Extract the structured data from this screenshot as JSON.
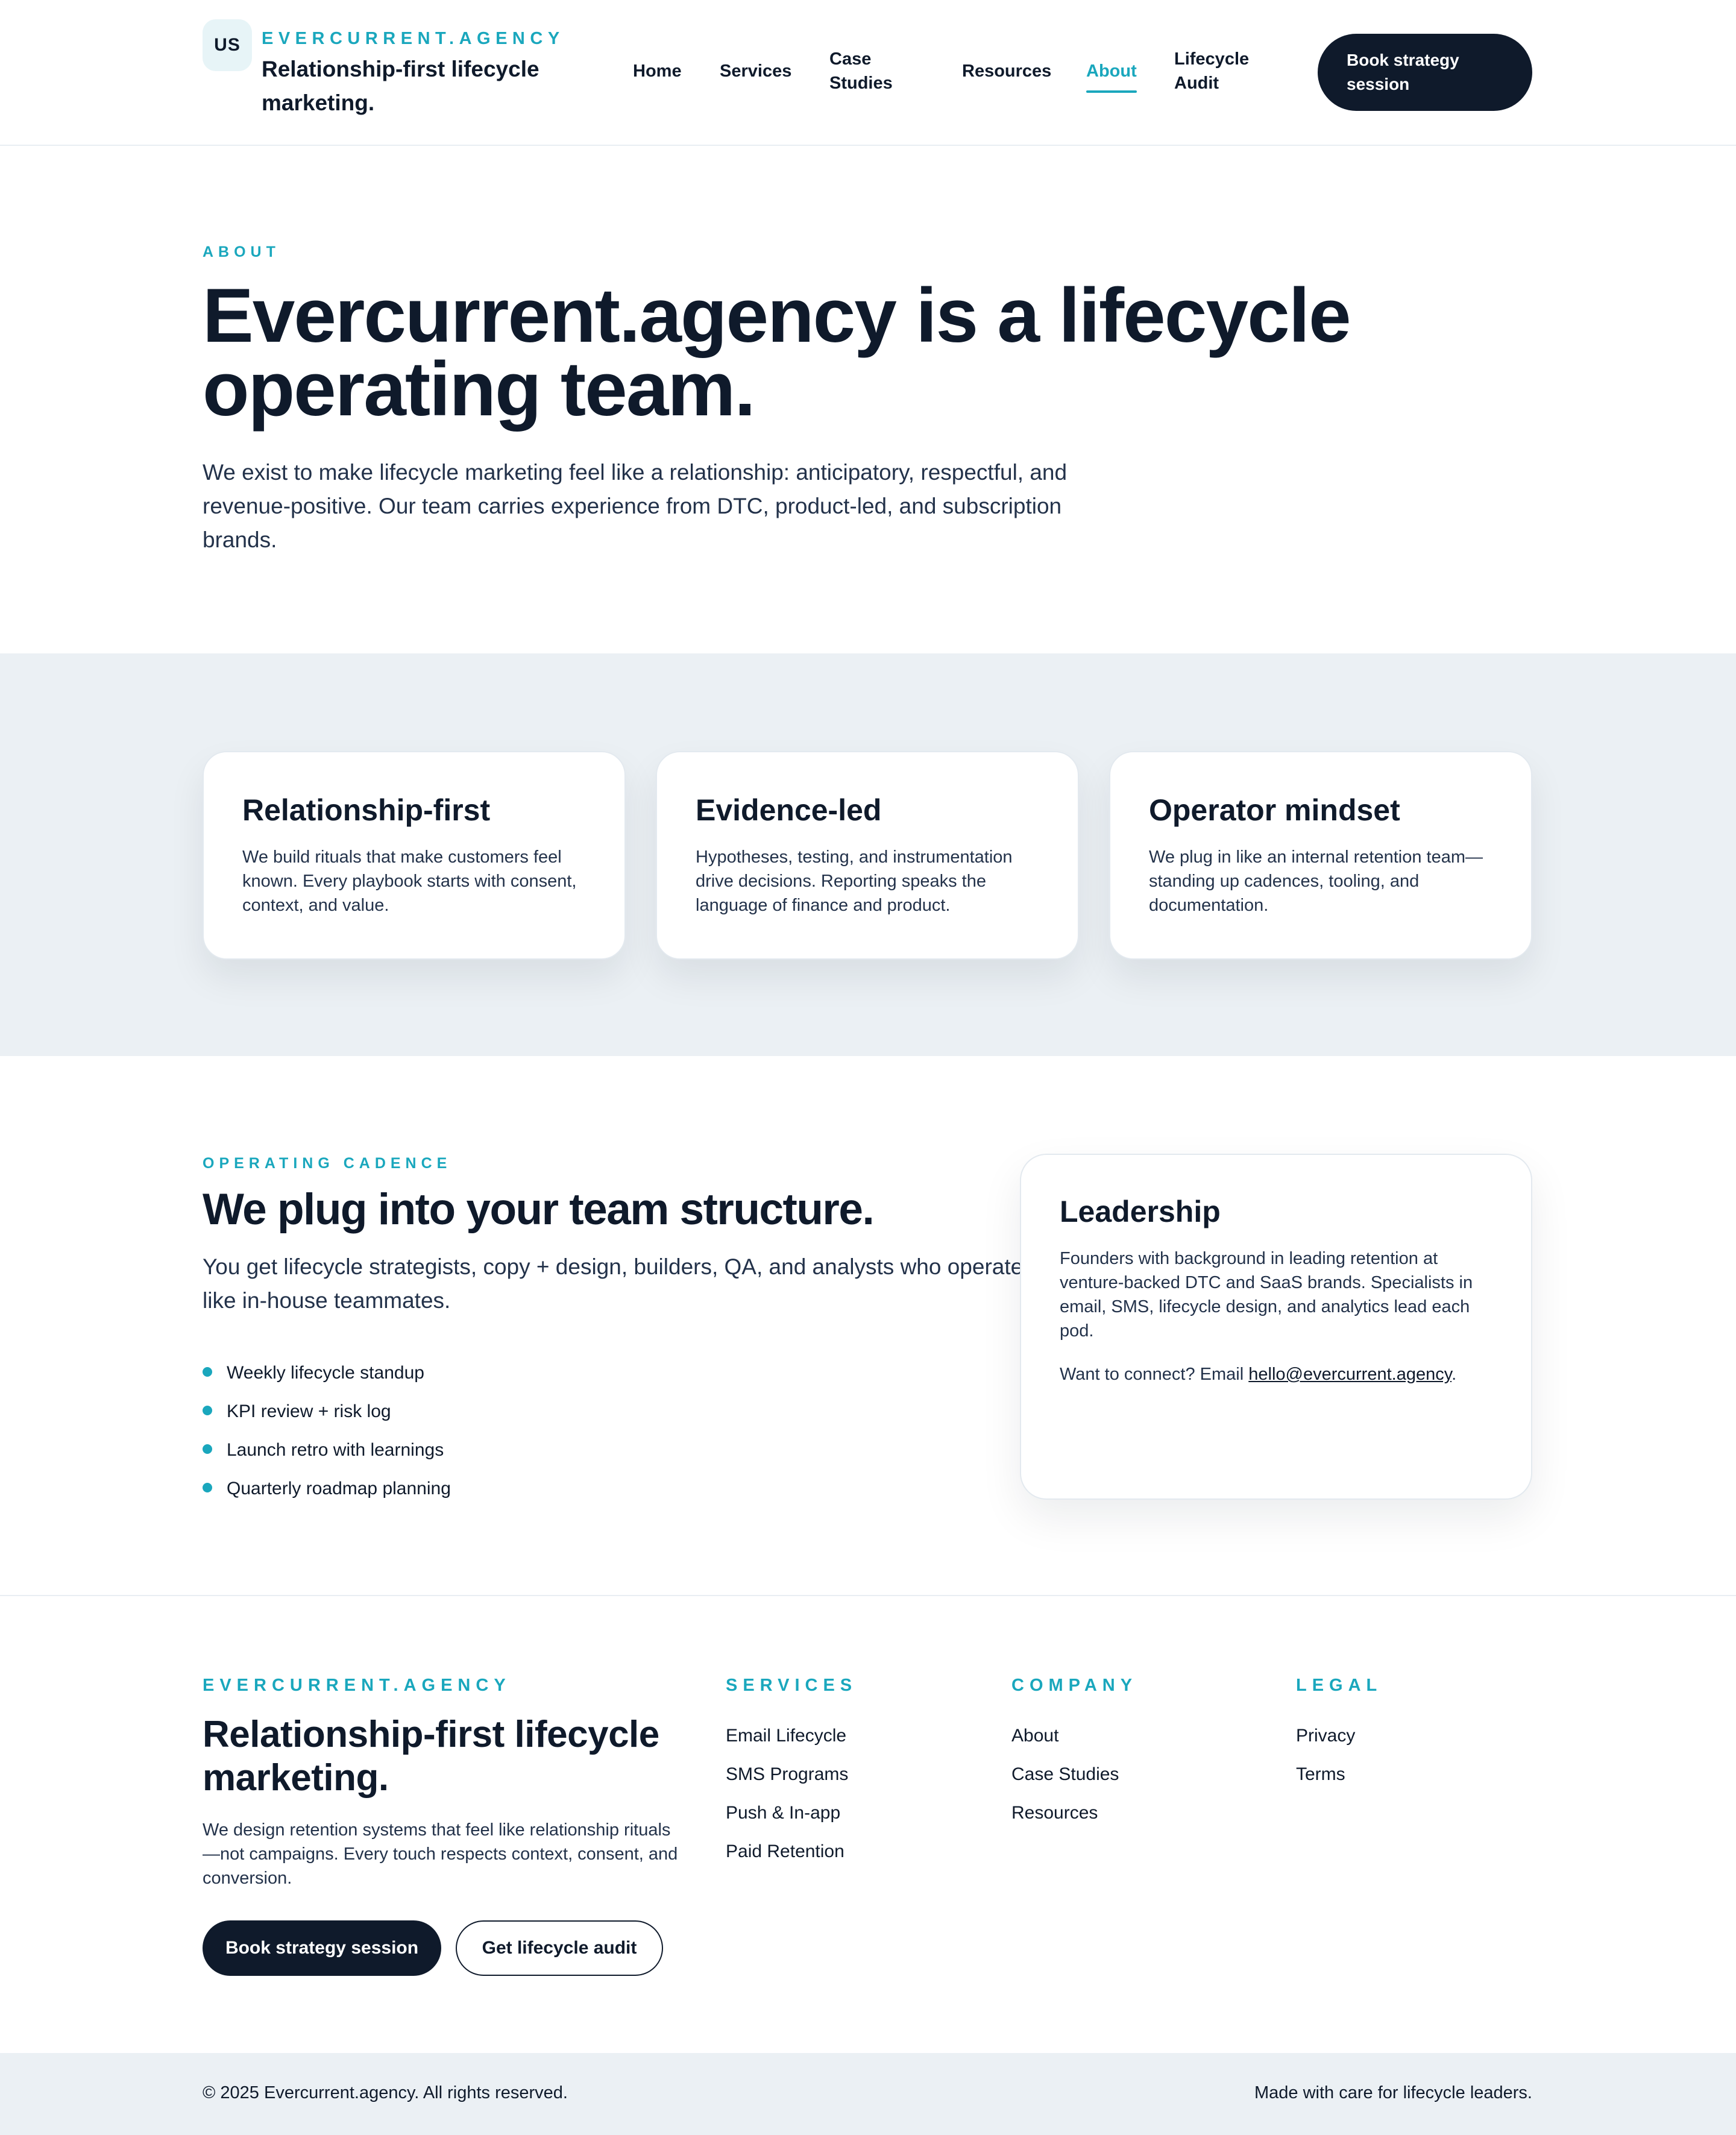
{
  "header": {
    "logo_text": "US",
    "brand_kicker": "EVERCURRENT.AGENCY",
    "brand_tagline": "Relationship-first lifecycle marketing.",
    "nav": [
      {
        "label": "Home"
      },
      {
        "label": "Services"
      },
      {
        "label": "Case Studies"
      },
      {
        "label": "Resources"
      },
      {
        "label": "About",
        "active": true
      },
      {
        "label": "Lifecycle Audit"
      }
    ],
    "cta_label": "Book strategy session"
  },
  "hero": {
    "kicker": "ABOUT",
    "title": "Evercurrent.agency is a lifecycle operating team.",
    "body": "We exist to make lifecycle marketing feel like a relationship: anticipatory, respectful, and revenue-positive. Our team carries experience from DTC, product-led, and subscription brands."
  },
  "values": [
    {
      "title": "Relationship-first",
      "body": "We build rituals that make customers feel known. Every playbook starts with consent, context, and value."
    },
    {
      "title": "Evidence-led",
      "body": "Hypotheses, testing, and instrumentation drive decisions. Reporting speaks the language of finance and product."
    },
    {
      "title": "Operator mindset",
      "body": "We plug in like an internal retention team—standing up cadences, tooling, and documentation."
    }
  ],
  "cadence": {
    "kicker": "OPERATING CADENCE",
    "title": "We plug into your team structure.",
    "lead": "You get lifecycle strategists, copy + design, builders, QA, and analysts who operate like in-house teammates.",
    "bullets": [
      "Weekly lifecycle standup",
      "KPI review + risk log",
      "Launch retro with learnings",
      "Quarterly roadmap planning"
    ],
    "leadership": {
      "title": "Leadership",
      "body": "Founders with background in leading retention at venture-backed DTC and SaaS brands. Specialists in email, SMS, lifecycle design, and analytics lead each pod.",
      "contact_prefix": "Want to connect? Email ",
      "email": "hello@evercurrent.agency",
      "contact_suffix": "."
    }
  },
  "footer": {
    "brand_kicker": "EVERCURRENT.AGENCY",
    "title": "Relationship-first lifecycle marketing.",
    "description": "We design retention systems that feel like relationship rituals—not campaigns. Every touch respects context, consent, and conversion.",
    "primary_button": "Book strategy session",
    "secondary_button": "Get lifecycle audit",
    "columns": [
      {
        "heading": "SERVICES",
        "links": [
          "Email Lifecycle",
          "SMS Programs",
          "Push & In-app",
          "Paid Retention"
        ]
      },
      {
        "heading": "COMPANY",
        "links": [
          "About",
          "Case Studies",
          "Resources"
        ]
      },
      {
        "heading": "LEGAL",
        "links": [
          "Privacy",
          "Terms"
        ]
      }
    ],
    "copyright": "© 2025 Evercurrent.agency. All rights reserved.",
    "made_with": "Made with care for lifecycle leaders."
  },
  "colors": {
    "accent": "#1aa7bd",
    "ink": "#0f1a2b",
    "band": "#ebf0f4"
  }
}
